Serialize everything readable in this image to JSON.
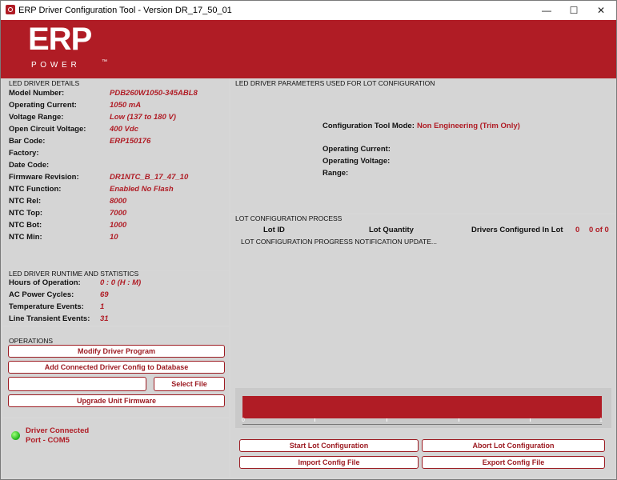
{
  "window": {
    "title": "ERP Driver Configuration Tool - Version DR_17_50_01",
    "controls": [
      "—",
      "☐",
      "✕"
    ]
  },
  "brand": {
    "logo_top": "ERP",
    "logo_bottom": "P O W E R",
    "trademark": "™",
    "color": "#b01c25"
  },
  "details": {
    "title": "LED DRIVER DETAILS",
    "rows": [
      {
        "label": "Model Number:",
        "value": "PDB260W1050-345ABL8"
      },
      {
        "label": "Operating Current:",
        "value": "1050 mA"
      },
      {
        "label": "Voltage Range:",
        "value": "Low (137 to 180 V)"
      },
      {
        "label": "Open Circuit Voltage:",
        "value": "400 Vdc"
      },
      {
        "label": "Bar Code:",
        "value": "ERP150176"
      },
      {
        "label": "Factory:",
        "value": ""
      },
      {
        "label": "Date Code:",
        "value": ""
      },
      {
        "label": "Firmware Revision:",
        "value": "DR1NTC_B_17_47_10"
      },
      {
        "label": "NTC Function:",
        "value": "Enabled No Flash"
      },
      {
        "label": "NTC Rel:",
        "value": "8000"
      },
      {
        "label": "NTC Top:",
        "value": "7000"
      },
      {
        "label": "NTC Bot:",
        "value": "1000"
      },
      {
        "label": "NTC Min:",
        "value": "10"
      }
    ]
  },
  "runtime": {
    "title": "LED DRIVER RUNTIME AND STATISTICS",
    "rows": [
      {
        "label": "Hours of Operation:",
        "value": "0 : 0   (H : M)"
      },
      {
        "label": "AC Power Cycles:",
        "value": "69"
      },
      {
        "label": "Temperature Events:",
        "value": "1"
      },
      {
        "label": "Line Transient Events:",
        "value": "31"
      }
    ]
  },
  "operations": {
    "title": "OPERATIONS",
    "modify": "Modify Driver Program",
    "add_config": "Add Connected Driver Config to Database",
    "file_value": "",
    "select_file": "Select File",
    "upgrade": "Upgrade Unit Firmware"
  },
  "status": {
    "line1": "Driver Connected",
    "line2": "Port - COM5",
    "led_color": "#1fb318"
  },
  "params": {
    "title": "LED DRIVER PARAMETERS USED FOR LOT CONFIGURATION",
    "mode_label": "Configuration Tool Mode:",
    "mode_value": "Non Engineering (Trim Only)",
    "current_label": "Operating Current:",
    "voltage_label": "Operating Voltage:",
    "range_label": "Range:"
  },
  "lot": {
    "title": "LOT CONFIGURATION PROCESS",
    "col_lot_id": "Lot ID",
    "col_quantity": "Lot Quantity",
    "col_configured": "Drivers Configured In Lot",
    "configured_value": "0",
    "total_value": "0 of 0",
    "progress_text": "LOT CONFIGURATION PROGRESS NOTIFICATION UPDATE...",
    "scale_left": "0",
    "scale_right": "1",
    "start": "Start Lot Configuration",
    "abort": "Abort Lot Configuration",
    "import": "Import Config File",
    "export": "Export Config File"
  }
}
